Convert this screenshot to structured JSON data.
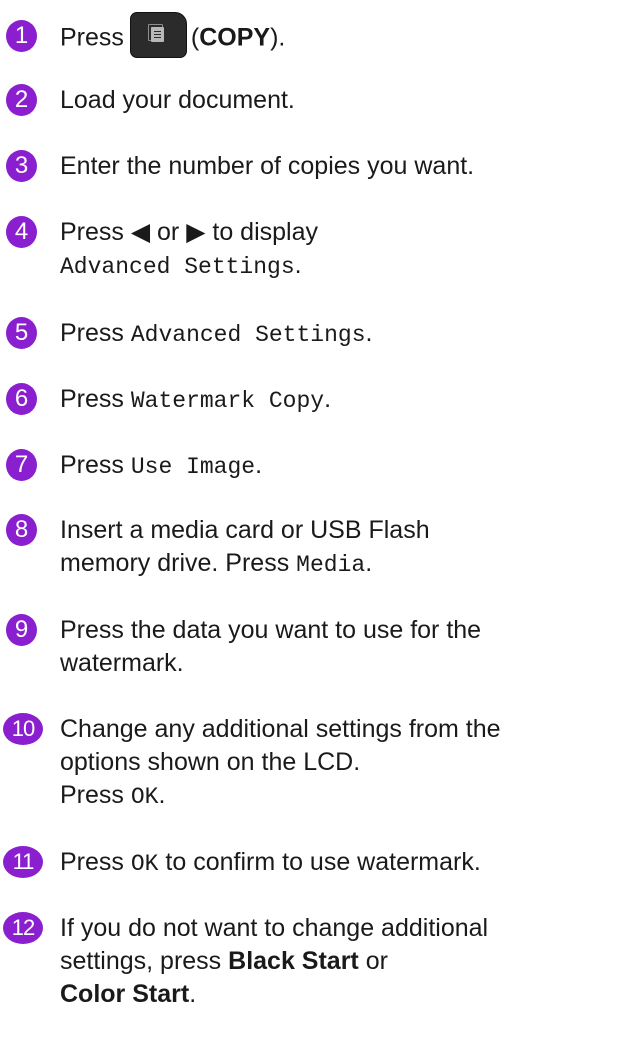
{
  "steps": [
    {
      "num": "1",
      "a": "Press",
      "b": "(",
      "c": "COPY",
      "d": ")."
    },
    {
      "num": "2",
      "text": "Load your document."
    },
    {
      "num": "3",
      "text": "Enter the number of copies you want."
    },
    {
      "num": "4",
      "a": "Press ◀ or ▶ to display",
      "mono": "Advanced Settings",
      "end": "."
    },
    {
      "num": "5",
      "a": "Press",
      "mono": "Advanced Settings",
      "end": "."
    },
    {
      "num": "6",
      "a": "Press",
      "mono": "Watermark Copy",
      "end": "."
    },
    {
      "num": "7",
      "a": "Press",
      "mono": "Use Image",
      "end": "."
    },
    {
      "num": "8",
      "l1": "Insert a media card or USB Flash",
      "a": "memory drive. Press",
      "mono": "Media",
      "end": "."
    },
    {
      "num": "9",
      "l1": "Press the data you want to use for the",
      "l2": "watermark."
    },
    {
      "num": "10",
      "l1": "Change any additional settings from the",
      "l2": "options shown on the LCD.",
      "a": "Press",
      "mono": "OK",
      "end": "."
    },
    {
      "num": "11",
      "a": "Press",
      "mono": "OK",
      "b": "to confirm to use watermark."
    },
    {
      "num": "12",
      "l1": "If you do not want to change additional",
      "a": "settings, press",
      "b1": "Black Start",
      "c": "or",
      "b2": "Color Start",
      "end": "."
    }
  ],
  "icons": {
    "copy_button": "copy-button-icon"
  },
  "colors": {
    "step_circle": "#8a1fd0"
  }
}
